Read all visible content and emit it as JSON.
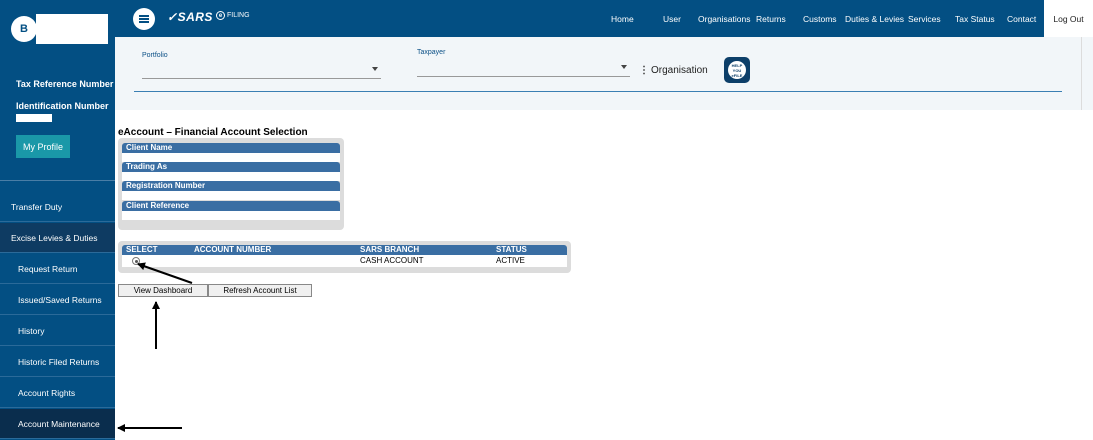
{
  "sidebar": {
    "avatar_initial": "B",
    "tax_reference_label": "Tax Reference Number",
    "identification_label": "Identification Number",
    "my_profile": "My Profile",
    "items": [
      {
        "label": "Transfer Duty"
      },
      {
        "label": "Excise Levies & Duties"
      },
      {
        "label": "Request Return"
      },
      {
        "label": "Issued/Saved Returns"
      },
      {
        "label": "History"
      },
      {
        "label": "Historic Filed Returns"
      },
      {
        "label": "Account Rights"
      },
      {
        "label": "Account Maintenance"
      }
    ]
  },
  "header": {
    "logo": "SARS",
    "efiling_label": "FILING",
    "nav": [
      "Home",
      "User",
      "Organisations",
      "Returns",
      "Customs",
      "Duties & Levies",
      "Services",
      "Tax Status",
      "Contact"
    ],
    "logout": "Log Out"
  },
  "filters": {
    "portfolio_label": "Portfolio",
    "taxpayer_label": "Taxpayer",
    "kebab": "⋮",
    "organisation_label": "Organisation",
    "help_text": "HELP YOU eFILE"
  },
  "page": {
    "title": "eAccount – Financial Account Selection"
  },
  "client_details": {
    "labels": [
      "Client Name",
      "Trading As",
      "Registration Number",
      "Client Reference"
    ]
  },
  "accounts": {
    "columns": [
      "SELECT",
      "ACCOUNT NUMBER",
      "SARS BRANCH",
      "STATUS"
    ],
    "rows": [
      {
        "branch": "CASH ACCOUNT",
        "status": "ACTIVE",
        "selected": true
      }
    ]
  },
  "buttons": {
    "view_dashboard": "View Dashboard",
    "refresh": "Refresh Account List"
  },
  "colors": {
    "brand_blue": "#034f83",
    "table_header": "#3a6ea3",
    "profile_button": "#1a98a8"
  }
}
